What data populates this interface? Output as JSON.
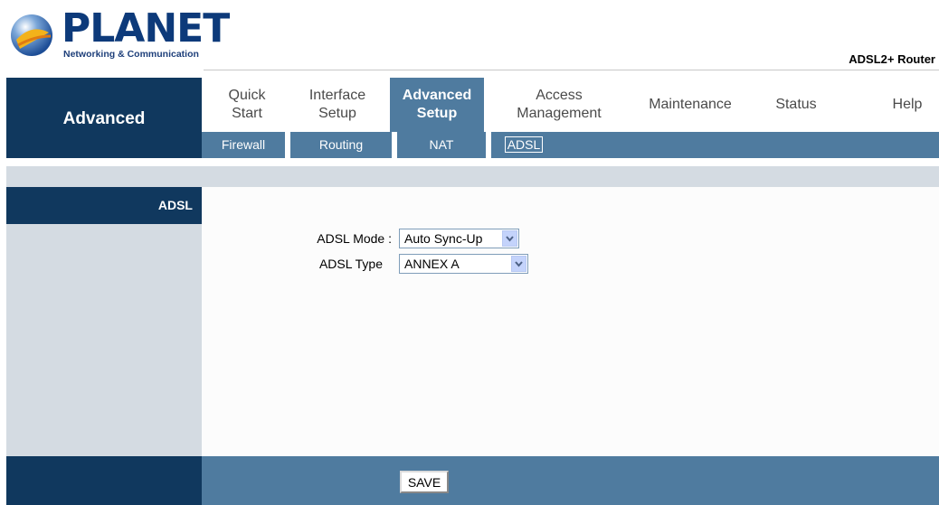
{
  "header": {
    "brand": "PLANET",
    "brand_sub": "Networking & Communication",
    "product": "ADSL2+ Router"
  },
  "nav": {
    "section": "Advanced",
    "tabs": [
      {
        "line1": "Quick",
        "line2": "Start"
      },
      {
        "line1": "Interface",
        "line2": "Setup"
      },
      {
        "line1": "Advanced",
        "line2": "Setup",
        "active": true
      },
      {
        "line1": "Access",
        "line2": "Management"
      },
      {
        "line1": "Maintenance",
        "line2": ""
      },
      {
        "line1": "Status",
        "line2": ""
      },
      {
        "line1": "Help",
        "line2": ""
      }
    ],
    "subtabs": [
      "Firewall",
      "Routing",
      "NAT",
      "ADSL"
    ],
    "active_subtab": "ADSL"
  },
  "sidebar": {
    "title": "ADSL"
  },
  "form": {
    "mode_label": "ADSL Mode :",
    "mode_value": "Auto Sync-Up",
    "type_label": "ADSL Type",
    "type_value": "ANNEX A"
  },
  "footer": {
    "save_label": "SAVE"
  },
  "colors": {
    "dark_navy": "#10385e",
    "steel_blue": "#4f7b9f",
    "light_grey": "#d4dbe2"
  }
}
